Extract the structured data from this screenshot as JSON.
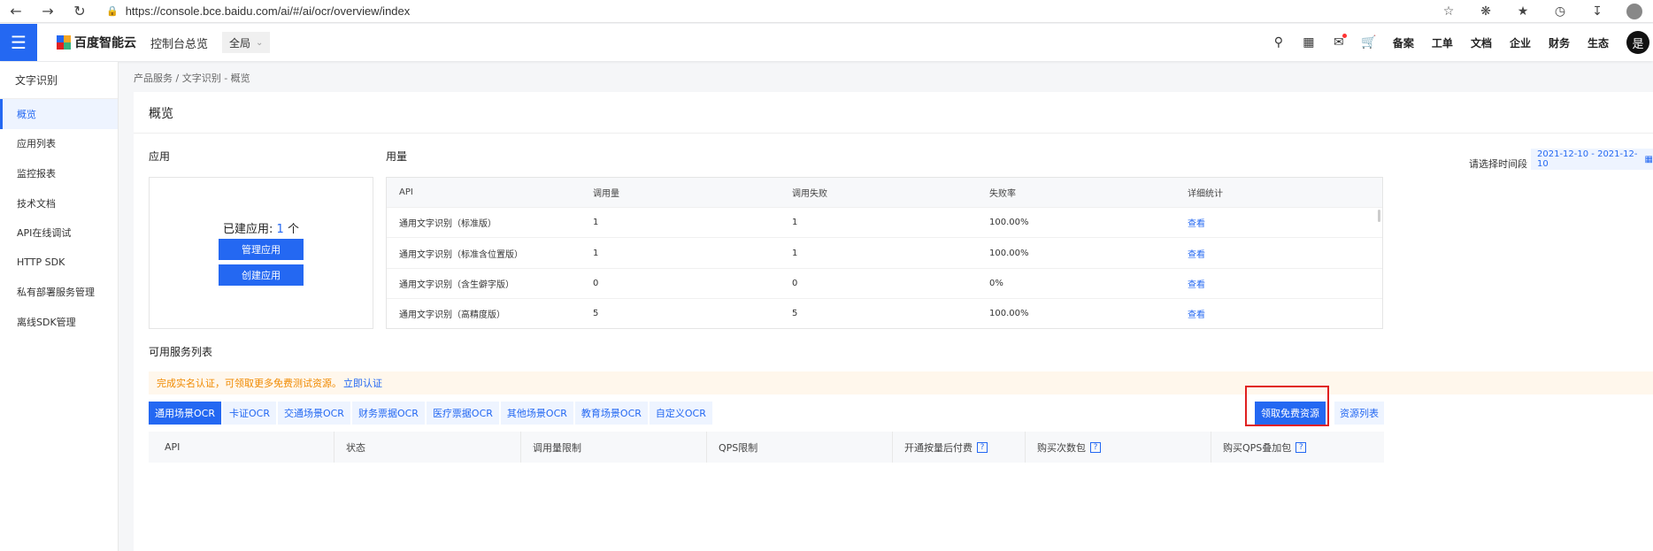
{
  "browser": {
    "url": "https://console.bce.baidu.com/ai/#/ai/ocr/overview/index"
  },
  "topnav": {
    "brand": "百度智能云",
    "console": "控制台总览",
    "region": "全局",
    "links": [
      "备案",
      "工单",
      "文档",
      "企业",
      "财务",
      "生态"
    ],
    "user_initial": "是"
  },
  "sidebar": {
    "title": "文字识别",
    "items": [
      {
        "label": "概览",
        "active": true
      },
      {
        "label": "应用列表"
      },
      {
        "label": "监控报表"
      },
      {
        "label": "技术文档"
      },
      {
        "label": "API在线调试"
      },
      {
        "label": "HTTP SDK"
      },
      {
        "label": "私有部署服务管理"
      },
      {
        "label": "离线SDK管理"
      }
    ]
  },
  "breadcrumb": "产品服务 / 文字识别 - 概览",
  "page": {
    "title": "概览",
    "apps_label": "应用",
    "usage_label": "用量",
    "apps_created_prefix": "已建应用:",
    "apps_created_count": "1",
    "apps_created_suffix": "个",
    "manage_btn": "管理应用",
    "create_btn": "创建应用",
    "date_label": "请选择时间段",
    "date_range": "2021-12-10 - 2021-12-10"
  },
  "usage_table": {
    "headers": [
      "API",
      "调用量",
      "调用失败",
      "失败率",
      "详细统计"
    ],
    "rows": [
      [
        "通用文字识别（标准版）",
        "1",
        "1",
        "100.00%",
        "查看"
      ],
      [
        "通用文字识别（标准含位置版）",
        "1",
        "1",
        "100.00%",
        "查看"
      ],
      [
        "通用文字识别（含生僻字版）",
        "0",
        "0",
        "0%",
        "查看"
      ],
      [
        "通用文字识别（高精度版）",
        "5",
        "5",
        "100.00%",
        "查看"
      ]
    ]
  },
  "services": {
    "title": "可用服务列表",
    "notice": "完成实名认证，可领取更多免费测试资源。",
    "notice_link": "立即认证",
    "tabs": [
      "通用场景OCR",
      "卡证OCR",
      "交通场景OCR",
      "财务票据OCR",
      "医疗票据OCR",
      "其他场景OCR",
      "教育场景OCR",
      "自定义OCR"
    ],
    "claim_btn": "领取免费资源",
    "resource_btn": "资源列表",
    "headers": [
      "API",
      "状态",
      "调用量限制",
      "QPS限制",
      "开通按量后付费",
      "购买次数包",
      "购买QPS叠加包"
    ]
  },
  "colors": {
    "accent": "#2468f2",
    "notice_text": "#f08a00",
    "highlight": "#e02020"
  }
}
